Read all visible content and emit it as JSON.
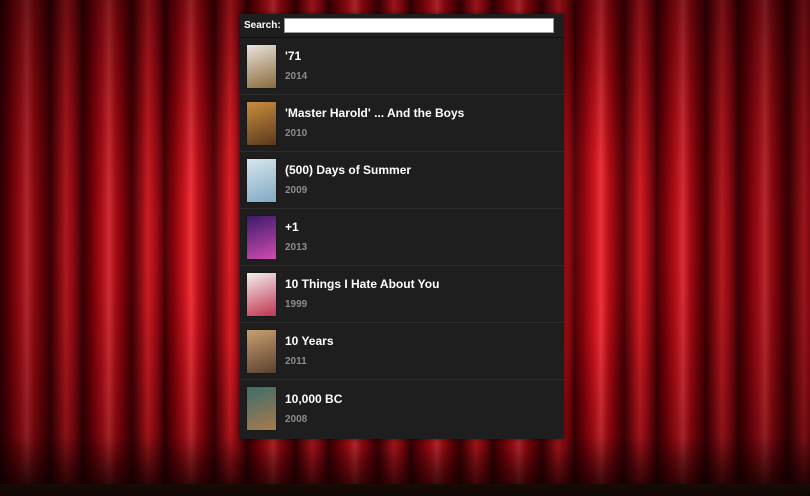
{
  "search": {
    "label": "Search:",
    "value": "",
    "placeholder": ""
  },
  "movies": [
    {
      "title": "'71",
      "year": "2014",
      "poster_colors": [
        "#e9e4da",
        "#8a6a3c"
      ]
    },
    {
      "title": "'Master Harold' ... And the Boys",
      "year": "2010",
      "poster_colors": [
        "#c98e3f",
        "#5a3a1c"
      ]
    },
    {
      "title": "(500) Days of Summer",
      "year": "2009",
      "poster_colors": [
        "#d8e6ee",
        "#7fa9c2"
      ]
    },
    {
      "title": "+1",
      "year": "2013",
      "poster_colors": [
        "#3a1a6a",
        "#d04bb0"
      ]
    },
    {
      "title": "10 Things I Hate About You",
      "year": "1999",
      "poster_colors": [
        "#f4f0ee",
        "#c0324e"
      ]
    },
    {
      "title": "10 Years",
      "year": "2011",
      "poster_colors": [
        "#c9a070",
        "#5b4030"
      ]
    },
    {
      "title": "10,000 BC",
      "year": "2008",
      "poster_colors": [
        "#3e6e6a",
        "#a87a4e"
      ]
    }
  ]
}
